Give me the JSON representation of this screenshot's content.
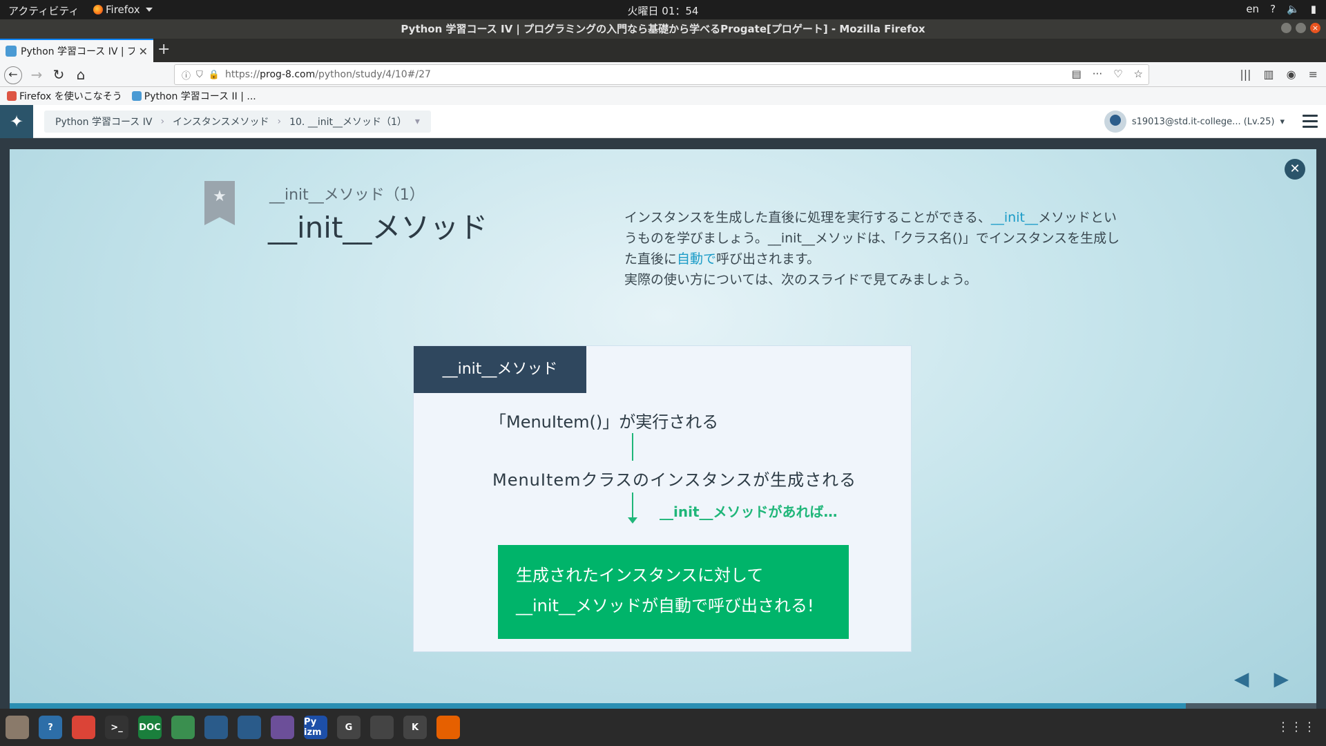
{
  "system": {
    "activities": "アクティビティ",
    "app_menu": "Firefox",
    "clock": "火曜日 01：54",
    "lang": "en"
  },
  "window": {
    "title": "Python 学習コース IV | プログラミングの入門なら基礎から学べるProgate[プロゲート] - Mozilla Firefox"
  },
  "browser": {
    "tab_title": "Python 学習コース IV | プ",
    "url_prefix": "https://",
    "url_host": "prog-8.com",
    "url_path": "/python/study/4/10#/27",
    "bookmarks": [
      {
        "label": "Firefox を使いこなそう"
      },
      {
        "label": "Python 学習コース II | ..."
      }
    ]
  },
  "progate": {
    "breadcrumb": [
      "Python 学習コース IV",
      "インスタンスメソッド",
      "10. __init__メソッド（1）"
    ],
    "user": "s19013@std.it-college... (Lv.25)"
  },
  "slide": {
    "subtitle": "__init__メソッド（1）",
    "title": "__init__メソッド",
    "desc_part1": "インスタンスを生成した直後に処理を実行することができる、",
    "desc_hl1": "__init__",
    "desc_part2": "メソッドというものを学びましょう。__init__メソッドは、「クラス名()」でインスタンスを生成した直後に",
    "desc_hl2": "自動で",
    "desc_part3": "呼び出されます。",
    "desc_line2": "実際の使い方については、次のスライドで見てみましょう。",
    "diagram": {
      "header": "__init__メソッド",
      "step1": "「MenuItem()」が実行される",
      "step2": "MenuItemクラスのインスタンスが生成される",
      "condition": "__init__メソッドがあれば…",
      "result_line1": "生成されたインスタンスに対して",
      "result_line2": "__init__メソッドが自動で呼び出される!"
    },
    "progress": 0.9
  },
  "taskbar": {
    "icons": [
      "files-icon",
      "help-icon",
      "chrome-icon",
      "terminal-icon",
      "doc-icon",
      "atom-icon",
      "eclipse-icon",
      "eclipse2-icon",
      "text-editor-icon",
      "pyizm-icon",
      "gimp-icon",
      "typora-icon",
      "krita-icon",
      "firefox-icon"
    ],
    "labels": [
      "",
      "?",
      "",
      ">_",
      "DOC",
      "",
      "",
      "",
      "",
      "Py izm",
      "G",
      "",
      "K",
      ""
    ]
  },
  "colors": {
    "accent": "#00b46a",
    "dark_header": "#2f475e",
    "link": "#1a9bc7"
  }
}
